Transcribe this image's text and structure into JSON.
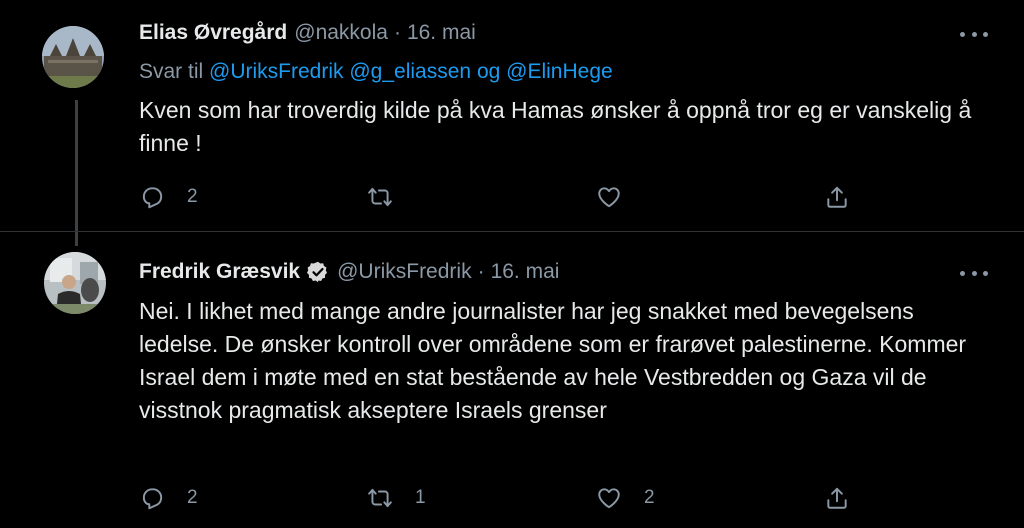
{
  "tweets": [
    {
      "author": {
        "name": "Elias Øvregård",
        "handle": "@nakkola",
        "verified": false
      },
      "date": "16. mai",
      "reply_to": {
        "prefix": "Svar til",
        "mention_1": "@UriksFredrik",
        "mention_2": "@g_eliassen",
        "joiner": "og",
        "mention_3": "@ElinHege"
      },
      "text": "Kven som har troverdig kilde på kva Hamas ønsker å oppnå tror eg er vanskelig å finne !",
      "stats": {
        "replies": "2",
        "retweets": "",
        "likes": ""
      }
    },
    {
      "author": {
        "name": "Fredrik Græsvik",
        "handle": "@UriksFredrik",
        "verified": true
      },
      "date": "16. mai",
      "text": "Nei. I likhet med mange andre journalister har jeg snakket med bevegelsens ledelse. De ønsker kontroll over områdene som er frarøvet palestinerne. Kommer Israel dem i møte med en stat bestående av hele Vestbredden og Gaza vil de visstnok pragmatisk akseptere Israels grenser",
      "stats": {
        "replies": "2",
        "retweets": "1",
        "likes": "2"
      }
    }
  ],
  "separator": "·",
  "icons": [
    "reply-icon",
    "retweet-icon",
    "like-icon",
    "share-icon",
    "more-options-icon",
    "verified-badge-icon"
  ],
  "colors": {
    "background": "#000000",
    "text": "#e7e9ea",
    "secondary": "#8b98a5",
    "link": "#1d9bf0"
  }
}
